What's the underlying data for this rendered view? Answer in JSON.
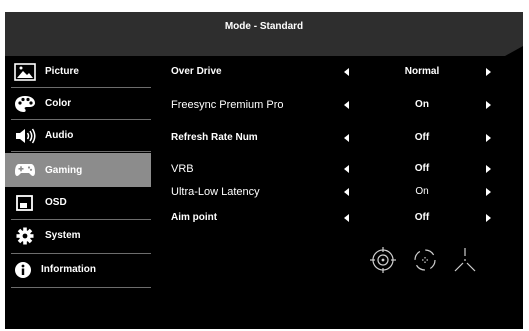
{
  "header": {
    "title": "Mode - Standard"
  },
  "sidebar": {
    "items": [
      {
        "label": "Picture",
        "icon": "picture-icon",
        "active": false
      },
      {
        "label": "Color",
        "icon": "palette-icon",
        "active": false
      },
      {
        "label": "Audio",
        "icon": "speaker-icon",
        "active": false
      },
      {
        "label": "Gaming",
        "icon": "gamepad-icon",
        "active": true
      },
      {
        "label": "OSD",
        "icon": "osd-window-icon",
        "active": false
      },
      {
        "label": "System",
        "icon": "gear-icon",
        "active": false
      },
      {
        "label": "Information",
        "icon": "info-icon",
        "active": false
      }
    ]
  },
  "settings": [
    {
      "label": "Over Drive",
      "value": "Normal"
    },
    {
      "label": "Freesync Premium Pro",
      "value": "On"
    },
    {
      "label": "Refresh Rate Num",
      "value": "Off"
    },
    {
      "label": "VRB",
      "value": "Off"
    },
    {
      "label": "Ultra-Low Latency",
      "value": "On"
    },
    {
      "label": "Aim point",
      "value": "Off"
    }
  ],
  "aim_point_options": [
    "crosshair-circle-icon",
    "crosshair-dashed-icon",
    "crosshair-tripod-icon"
  ],
  "colors": {
    "background": "#000000",
    "header": "#2e2e2e",
    "active_item": "#8c8c8c",
    "text": "#ffffff"
  }
}
